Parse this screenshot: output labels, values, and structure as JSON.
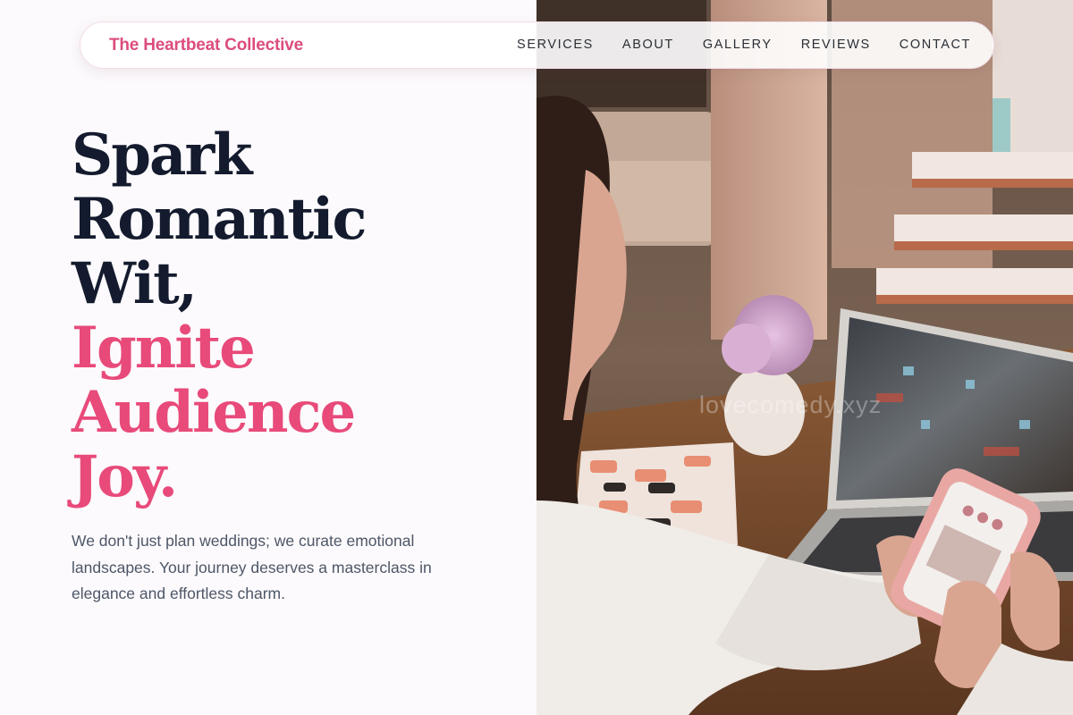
{
  "brand": {
    "name": "The Heartbeat Collective",
    "color": "#dc4d7d"
  },
  "nav": {
    "links": [
      "SERVICES",
      "ABOUT",
      "GALLERY",
      "REVIEWS",
      "CONTACT"
    ]
  },
  "hero": {
    "headline_dark": [
      "Spark",
      "Romantic",
      "Wit,"
    ],
    "headline_accent": [
      "Ignite",
      "Audience",
      "Joy."
    ],
    "lede": "We don't just plan weddings; we curate emotional landscapes. Your journey deserves a masterclass in elegance and effortless charm.",
    "accent_color": "#e84a7a",
    "dark_color": "#141b2e"
  },
  "photo": {
    "watermark": "lovecomedy.xyz",
    "description_icon": "photo-woman-with-laptop-and-phone"
  }
}
